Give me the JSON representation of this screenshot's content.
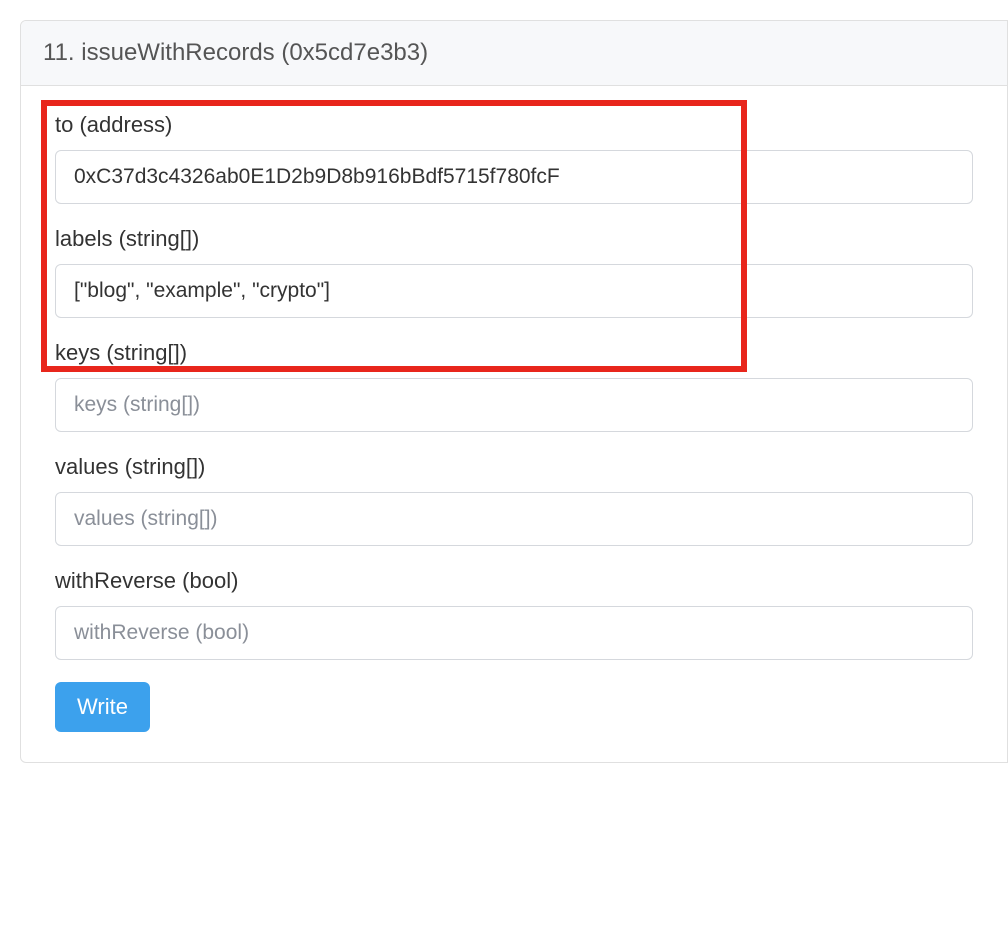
{
  "function": {
    "index": "11.",
    "name": "issueWithRecords",
    "selector": "(0x5cd7e3b3)"
  },
  "fields": {
    "to": {
      "label": "to (address)",
      "value": "0xC37d3c4326ab0E1D2b9D8b916bBdf5715f780fcF",
      "placeholder": "to (address)"
    },
    "labels": {
      "label": "labels (string[])",
      "value": "[\"blog\", \"example\", \"crypto\"]",
      "placeholder": "labels (string[])"
    },
    "keys": {
      "label": "keys (string[])",
      "value": "",
      "placeholder": "keys (string[])"
    },
    "values": {
      "label": "values (string[])",
      "value": "",
      "placeholder": "values (string[])"
    },
    "withReverse": {
      "label": "withReverse (bool)",
      "value": "",
      "placeholder": "withReverse (bool)"
    }
  },
  "actions": {
    "write": "Write"
  }
}
